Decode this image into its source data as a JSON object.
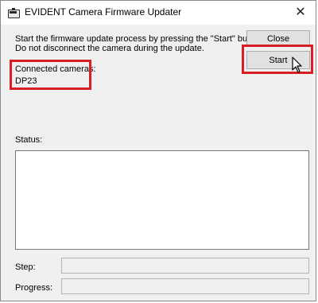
{
  "window": {
    "title": "EVIDENT Camera Firmware Updater",
    "close_glyph": "✕"
  },
  "instructions": {
    "line1": "Start the firmware update process by pressing the \"Start\" button.",
    "line2": "Do not disconnect the camera during the update."
  },
  "buttons": {
    "close_label": "Close",
    "start_label": "Start"
  },
  "cameras": {
    "label": "Connected cameras:",
    "value": "DP23"
  },
  "status": {
    "label": "Status:",
    "text": ""
  },
  "step": {
    "label": "Step:",
    "value": ""
  },
  "progress": {
    "label": "Progress:",
    "value": 0
  },
  "colors": {
    "highlight": "#d91e26"
  },
  "icons": {
    "app": "camera-icon",
    "pointer": "mouse-pointer-icon"
  }
}
